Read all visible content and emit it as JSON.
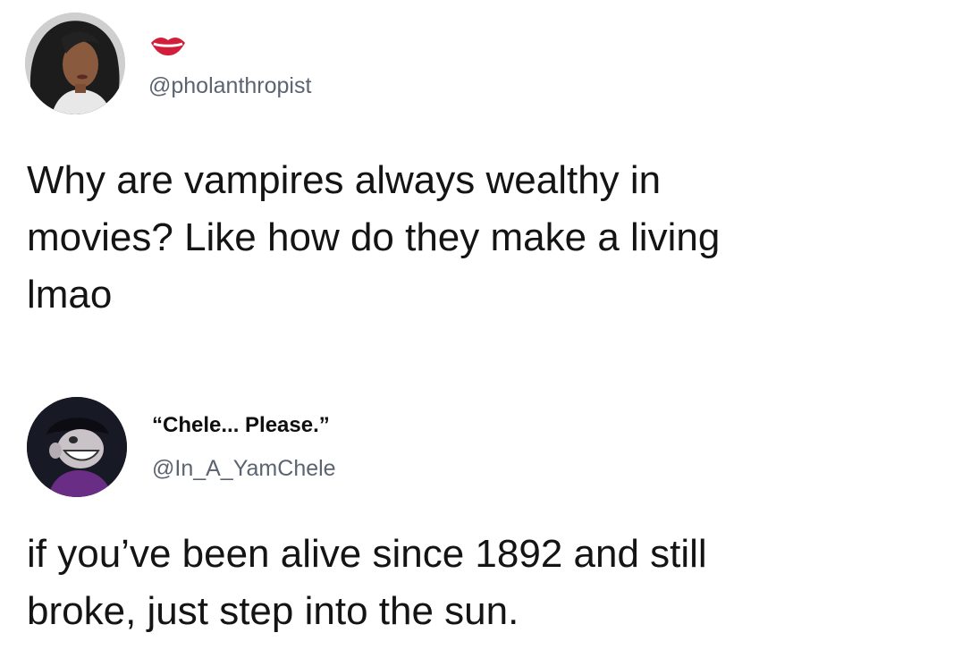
{
  "tweets": [
    {
      "display_name": "",
      "name_icon": "lips-icon",
      "handle": "@pholanthropist",
      "text_lines": [
        "Why are vampires always wealthy in",
        "movies? Like how do they make a living",
        "lmao"
      ]
    },
    {
      "display_name": "“Chele... Please.”",
      "handle": "@In_A_YamChele",
      "text_lines": [
        "if you’ve been alive since 1892 and still",
        "broke, just step into the sun."
      ]
    }
  ],
  "colors": {
    "background": "#ffffff",
    "text": "#141414",
    "handle": "#5b6470",
    "lips": "#d21e3a"
  }
}
